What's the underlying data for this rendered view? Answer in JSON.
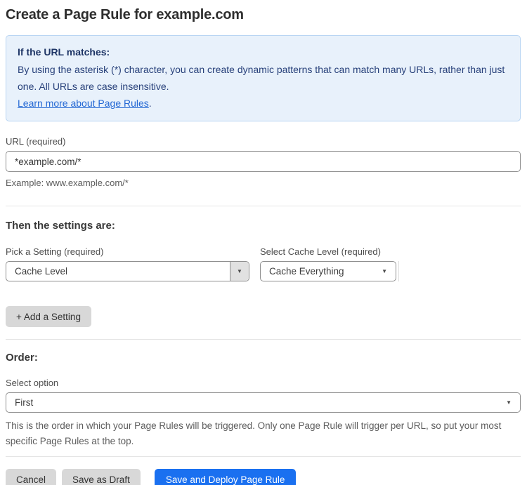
{
  "page": {
    "title": "Create a Page Rule for example.com"
  },
  "info_box": {
    "heading": "If the URL matches:",
    "body": "By using the asterisk (*) character, you can create dynamic patterns that can match many URLs, rather than just one. All URLs are case insensitive.",
    "link_label": "Learn more about Page Rules",
    "link_suffix": "."
  },
  "url_field": {
    "label": "URL (required)",
    "value": "*example.com/*",
    "example": "Example: www.example.com/*"
  },
  "settings_section": {
    "heading": "Then the settings are:",
    "setting_picker": {
      "label": "Pick a Setting (required)",
      "selected_value": "Cache Level"
    },
    "cache_level_picker": {
      "label": "Select Cache Level (required)",
      "selected_value": "Cache Everything"
    },
    "add_setting_button": "+ Add a Setting"
  },
  "order_section": {
    "heading": "Order:",
    "label": "Select option",
    "selected_value": "First",
    "help": "This is the order in which your Page Rules will be triggered. Only one Page Rule will trigger per URL, so put your most specific Page Rules at the top."
  },
  "actions": {
    "cancel": "Cancel",
    "save_draft": "Save as Draft",
    "save_deploy": "Save and Deploy Page Rule"
  },
  "icons": {
    "dropdown_caret": "▼"
  },
  "colors": {
    "primary_button": "#1a70f0",
    "info_box_bg": "#e8f1fb",
    "info_box_border": "#b9d5f3",
    "info_text": "#27407a",
    "link": "#2569d4",
    "gray_button": "#d8d8d8",
    "input_border": "#8f8f8f",
    "divider": "#e4e4e4"
  }
}
